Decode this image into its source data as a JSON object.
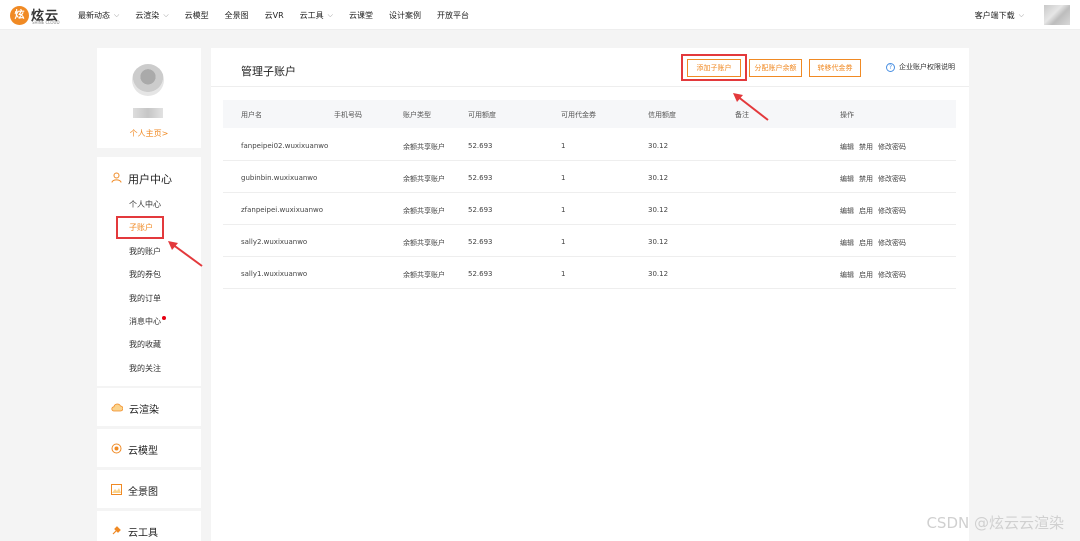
{
  "topnav": {
    "logo_mark": "炫",
    "logo_text": "炫云",
    "logo_sub": "SHINE CLOUD",
    "items": [
      {
        "label": "最新动态",
        "has_dropdown": true
      },
      {
        "label": "云渲染",
        "has_dropdown": true
      },
      {
        "label": "云模型",
        "has_dropdown": false
      },
      {
        "label": "全景图",
        "has_dropdown": false
      },
      {
        "label": "云VR",
        "has_dropdown": false
      },
      {
        "label": "云工具",
        "has_dropdown": true
      },
      {
        "label": "云课堂",
        "has_dropdown": false
      },
      {
        "label": "设计案例",
        "has_dropdown": false
      },
      {
        "label": "开放平台",
        "has_dropdown": false
      }
    ],
    "download_label": "客户端下载",
    "chevron": "⌵"
  },
  "profile": {
    "homepage_link": "个人主页>"
  },
  "menu": {
    "head_icon": "person-icon",
    "head_label": "用户中心",
    "items": [
      {
        "label": "个人中心"
      },
      {
        "label": "子账户"
      },
      {
        "label": "我的账户"
      },
      {
        "label": "我的券包"
      },
      {
        "label": "我的订单"
      },
      {
        "label": "消息中心"
      },
      {
        "label": "我的收藏"
      },
      {
        "label": "我的关注"
      }
    ]
  },
  "sections": [
    {
      "label": "云渲染",
      "icon": "cloud-icon"
    },
    {
      "label": "云模型",
      "icon": "cube-icon"
    },
    {
      "label": "全景图",
      "icon": "panorama-icon"
    },
    {
      "label": "云工具",
      "icon": "tool-icon"
    }
  ],
  "main": {
    "title": "管理子账户",
    "buttons": {
      "add": "添加子账户",
      "allocate": "分配账户余额",
      "transfer": "转移代金券"
    },
    "help": "企业账户权限说明",
    "columns": [
      "用户名",
      "手机号码",
      "账户类型",
      "可用额度",
      "可用代金券",
      "信用额度",
      "备注",
      "操作"
    ],
    "rows": [
      {
        "username": "fanpeipei02.wuxixuanwo",
        "phone": "",
        "type": "余额共享账户",
        "quota": "52.693",
        "vouchers": "1",
        "credit": "30.12",
        "note": "",
        "ops": [
          "编辑",
          "禁用",
          "修改密码"
        ]
      },
      {
        "username": "gubinbin.wuxixuanwo",
        "phone": "",
        "type": "余额共享账户",
        "quota": "52.693",
        "vouchers": "1",
        "credit": "30.12",
        "note": "",
        "ops": [
          "编辑",
          "禁用",
          "修改密码"
        ]
      },
      {
        "username": "zfanpeipei.wuxixuanwo",
        "phone": "",
        "type": "余额共享账户",
        "quota": "52.693",
        "vouchers": "1",
        "credit": "30.12",
        "note": "",
        "ops": [
          "编辑",
          "启用",
          "修改密码"
        ]
      },
      {
        "username": "sally2.wuxixuanwo",
        "phone": "",
        "type": "余额共享账户",
        "quota": "52.693",
        "vouchers": "1",
        "credit": "30.12",
        "note": "",
        "ops": [
          "编辑",
          "启用",
          "修改密码"
        ]
      },
      {
        "username": "sally1.wuxixuanwo",
        "phone": "",
        "type": "余额共享账户",
        "quota": "52.693",
        "vouchers": "1",
        "credit": "30.12",
        "note": "",
        "ops": [
          "编辑",
          "启用",
          "修改密码"
        ]
      }
    ]
  },
  "watermark": "CSDN @炫云云渲染",
  "colors": {
    "accent": "#f08a24",
    "annotation": "#e3393c",
    "notification": "#e60012",
    "help": "#4a90e2"
  }
}
